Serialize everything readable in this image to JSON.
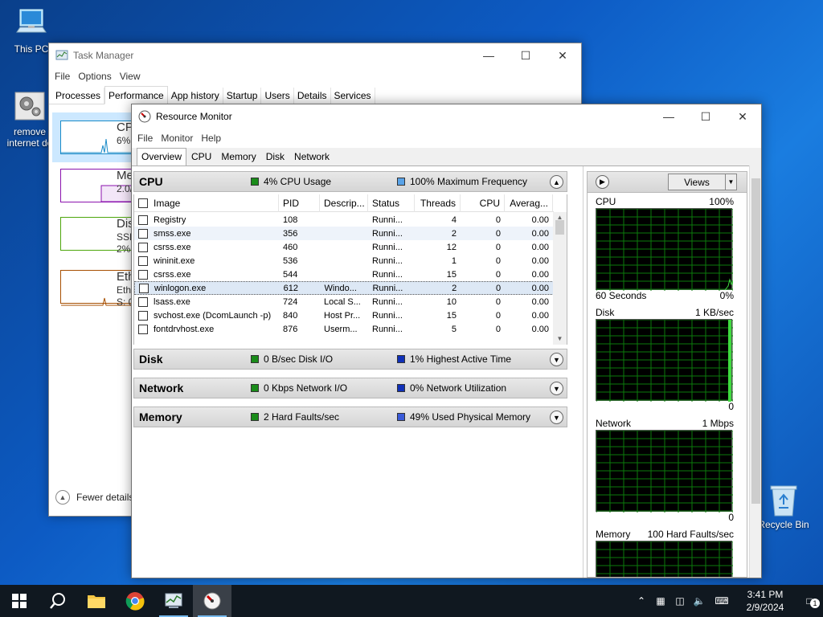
{
  "desktop": {
    "icons": [
      {
        "label": "This PC"
      },
      {
        "label": "remove internet de"
      },
      {
        "label": "Recycle Bin"
      }
    ]
  },
  "task_manager": {
    "title": "Task Manager",
    "menu": [
      "File",
      "Options",
      "View"
    ],
    "tabs": [
      "Processes",
      "Performance",
      "App history",
      "Startup",
      "Users",
      "Details",
      "Services"
    ],
    "active_tab": "Performance",
    "perf_items": [
      {
        "label": "CP",
        "sub": "6%",
        "color": "#1a8bc8"
      },
      {
        "label": "Me",
        "sub": "2.0/",
        "color": "#8b12ae"
      },
      {
        "label": "Dis",
        "sub": "SSD",
        "sub2": "2%",
        "color": "#4da60c"
      },
      {
        "label": "Eth",
        "sub": "Eth",
        "sub2": "S: 0",
        "color": "#a74f01"
      }
    ],
    "fewer_details": "Fewer details"
  },
  "resource_monitor": {
    "title": "Resource Monitor",
    "menu": [
      "File",
      "Monitor",
      "Help"
    ],
    "tabs": [
      "Overview",
      "CPU",
      "Memory",
      "Disk",
      "Network"
    ],
    "active_tab": "Overview",
    "sections": {
      "cpu": {
        "name": "CPU",
        "m1": "4% CPU Usage",
        "m1_color": "#1a8c1a",
        "m2": "100% Maximum Frequency",
        "m2_color": "#59a3e8"
      },
      "disk": {
        "name": "Disk",
        "m1": "0 B/sec Disk I/O",
        "m1_color": "#1a8c1a",
        "m2": "1% Highest Active Time",
        "m2_color": "#1030b8"
      },
      "network": {
        "name": "Network",
        "m1": "0 Kbps Network I/O",
        "m1_color": "#1a8c1a",
        "m2": "0% Network Utilization",
        "m2_color": "#1030b8"
      },
      "memory": {
        "name": "Memory",
        "m1": "2 Hard Faults/sec",
        "m1_color": "#1a8c1a",
        "m2": "49% Used Physical Memory",
        "m2_color": "#3a5ad8"
      }
    },
    "columns": [
      "Image",
      "PID",
      "Descrip...",
      "Status",
      "Threads",
      "CPU",
      "Averag..."
    ],
    "rows": [
      {
        "image": "Registry",
        "pid": "108",
        "desc": "",
        "status": "Runni...",
        "threads": "4",
        "cpu": "0",
        "avg": "0.00"
      },
      {
        "image": "smss.exe",
        "pid": "356",
        "desc": "",
        "status": "Runni...",
        "threads": "2",
        "cpu": "0",
        "avg": "0.00"
      },
      {
        "image": "csrss.exe",
        "pid": "460",
        "desc": "",
        "status": "Runni...",
        "threads": "12",
        "cpu": "0",
        "avg": "0.00"
      },
      {
        "image": "wininit.exe",
        "pid": "536",
        "desc": "",
        "status": "Runni...",
        "threads": "1",
        "cpu": "0",
        "avg": "0.00"
      },
      {
        "image": "csrss.exe",
        "pid": "544",
        "desc": "",
        "status": "Runni...",
        "threads": "15",
        "cpu": "0",
        "avg": "0.00"
      },
      {
        "image": "winlogon.exe",
        "pid": "612",
        "desc": "Windo...",
        "status": "Runni...",
        "threads": "2",
        "cpu": "0",
        "avg": "0.00"
      },
      {
        "image": "lsass.exe",
        "pid": "724",
        "desc": "Local S...",
        "status": "Runni...",
        "threads": "10",
        "cpu": "0",
        "avg": "0.00"
      },
      {
        "image": "svchost.exe (DcomLaunch -p)",
        "pid": "840",
        "desc": "Host Pr...",
        "status": "Runni...",
        "threads": "15",
        "cpu": "0",
        "avg": "0.00"
      },
      {
        "image": "fontdrvhost.exe",
        "pid": "876",
        "desc": "Userm...",
        "status": "Runni...",
        "threads": "5",
        "cpu": "0",
        "avg": "0.00"
      }
    ],
    "graphs": {
      "views_label": "Views",
      "cpu": {
        "name": "CPU",
        "max": "100%",
        "foot_left": "60 Seconds",
        "foot_right": "0%"
      },
      "disk": {
        "name": "Disk",
        "max": "1 KB/sec",
        "foot_left": "",
        "foot_right": "0"
      },
      "network": {
        "name": "Network",
        "max": "1 Mbps",
        "foot_left": "",
        "foot_right": "0"
      },
      "memory": {
        "name": "Memory",
        "max": "100 Hard Faults/sec"
      }
    }
  },
  "taskbar": {
    "clock_time": "3:41 PM",
    "clock_date": "2/9/2024",
    "notification_count": "1"
  }
}
